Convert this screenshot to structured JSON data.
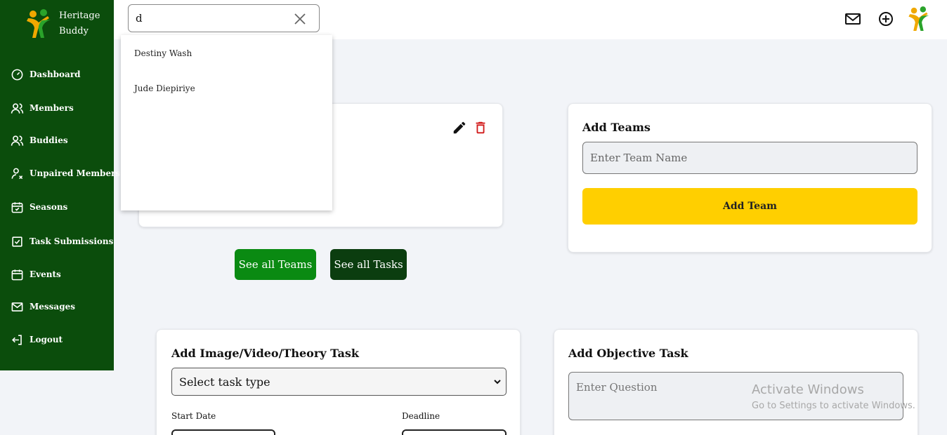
{
  "brand": {
    "line1": "Heritage",
    "line2": "Buddy",
    "logo_icon": "heritage-buddy-logo"
  },
  "sidebar": {
    "items": [
      {
        "label": "Dashboard",
        "icon": "dashboard-gauge-icon"
      },
      {
        "label": "Members",
        "icon": "users-icon"
      },
      {
        "label": "Buddies",
        "icon": "users-icon"
      },
      {
        "label": "Unpaired Members",
        "icon": "user-x-icon"
      },
      {
        "label": "Seasons",
        "icon": "calendar-check-icon"
      },
      {
        "label": "Task Submissions",
        "icon": "checkbox-icon"
      },
      {
        "label": "Events",
        "icon": "calendar-icon"
      },
      {
        "label": "Messages",
        "icon": "mail-icon"
      },
      {
        "label": "Logout",
        "icon": "logout-icon"
      }
    ]
  },
  "search": {
    "value": "d",
    "placeholder": ""
  },
  "dropdown": {
    "results": [
      "Destiny Wash",
      "Jude Diepiriye"
    ]
  },
  "teams_card": {
    "actions": [
      "edit-icon",
      "delete-icon"
    ]
  },
  "buttons": {
    "see_all_teams": "See all Teams",
    "see_all_tasks": "See all Tasks"
  },
  "add_teams": {
    "title": "Add Teams",
    "input_placeholder": "Enter Team Name",
    "button": "Add Team"
  },
  "task_form": {
    "title": "Add Image/Video/Theory Task",
    "select_value": "Select task type",
    "start_date_label": "Start Date",
    "deadline_label": "Deadline"
  },
  "objective_task": {
    "title": "Add Objective Task",
    "question_placeholder": "Enter Question"
  },
  "watermark": {
    "line1": "Activate Windows",
    "line2": "Go to Settings to activate Windows."
  },
  "colors": {
    "sidebar": "#0b4d0c",
    "accent_yellow": "#ffcf00",
    "see_teams_green": "#0a8a12",
    "see_tasks_green": "#0b3d0f",
    "delete_red": "#d11a1a"
  }
}
